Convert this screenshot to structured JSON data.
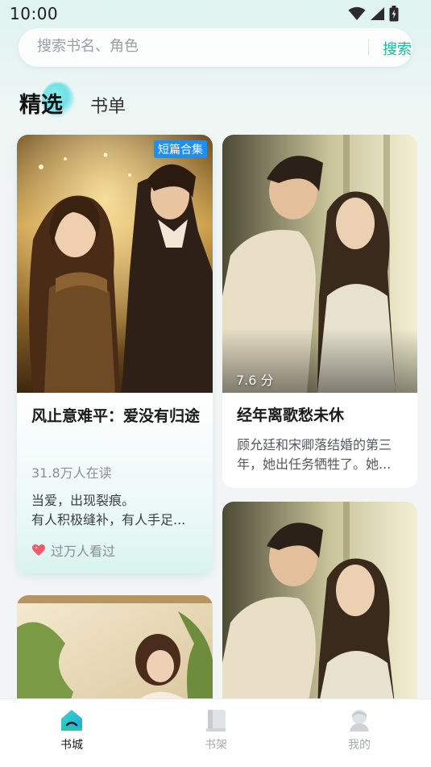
{
  "status_bar": {
    "time": "10:00",
    "icons": [
      "wifi-icon",
      "signal-icon",
      "battery-icon"
    ]
  },
  "search": {
    "placeholder": "搜索书名、角色",
    "button_label": "搜索"
  },
  "tabs": [
    {
      "label": "精选",
      "active": true
    },
    {
      "label": "书单",
      "active": false
    }
  ],
  "cards": [
    {
      "badge": "短篇合集",
      "title": "风止意难平：爱没有归途",
      "readers": "31.8万人在读",
      "desc_lines": [
        "当爱，出现裂痕。",
        "有人积极缝补，有人手足..."
      ],
      "viewed": "过万人看过"
    },
    {
      "score": "7.6 分",
      "title": "经年离歌愁未休",
      "desc_lines": [
        "顾允廷和宋卿落结婚的第三",
        "年，她出任务牺牲了。她..."
      ]
    }
  ],
  "bottom_nav": [
    {
      "label": "书城",
      "icon": "bookstore-icon",
      "active": true
    },
    {
      "label": "书架",
      "icon": "bookshelf-icon",
      "active": false
    },
    {
      "label": "我的",
      "icon": "profile-icon",
      "active": false
    }
  ],
  "colors": {
    "accent": "#1bbc9b",
    "badge": "#1f8ef1"
  }
}
